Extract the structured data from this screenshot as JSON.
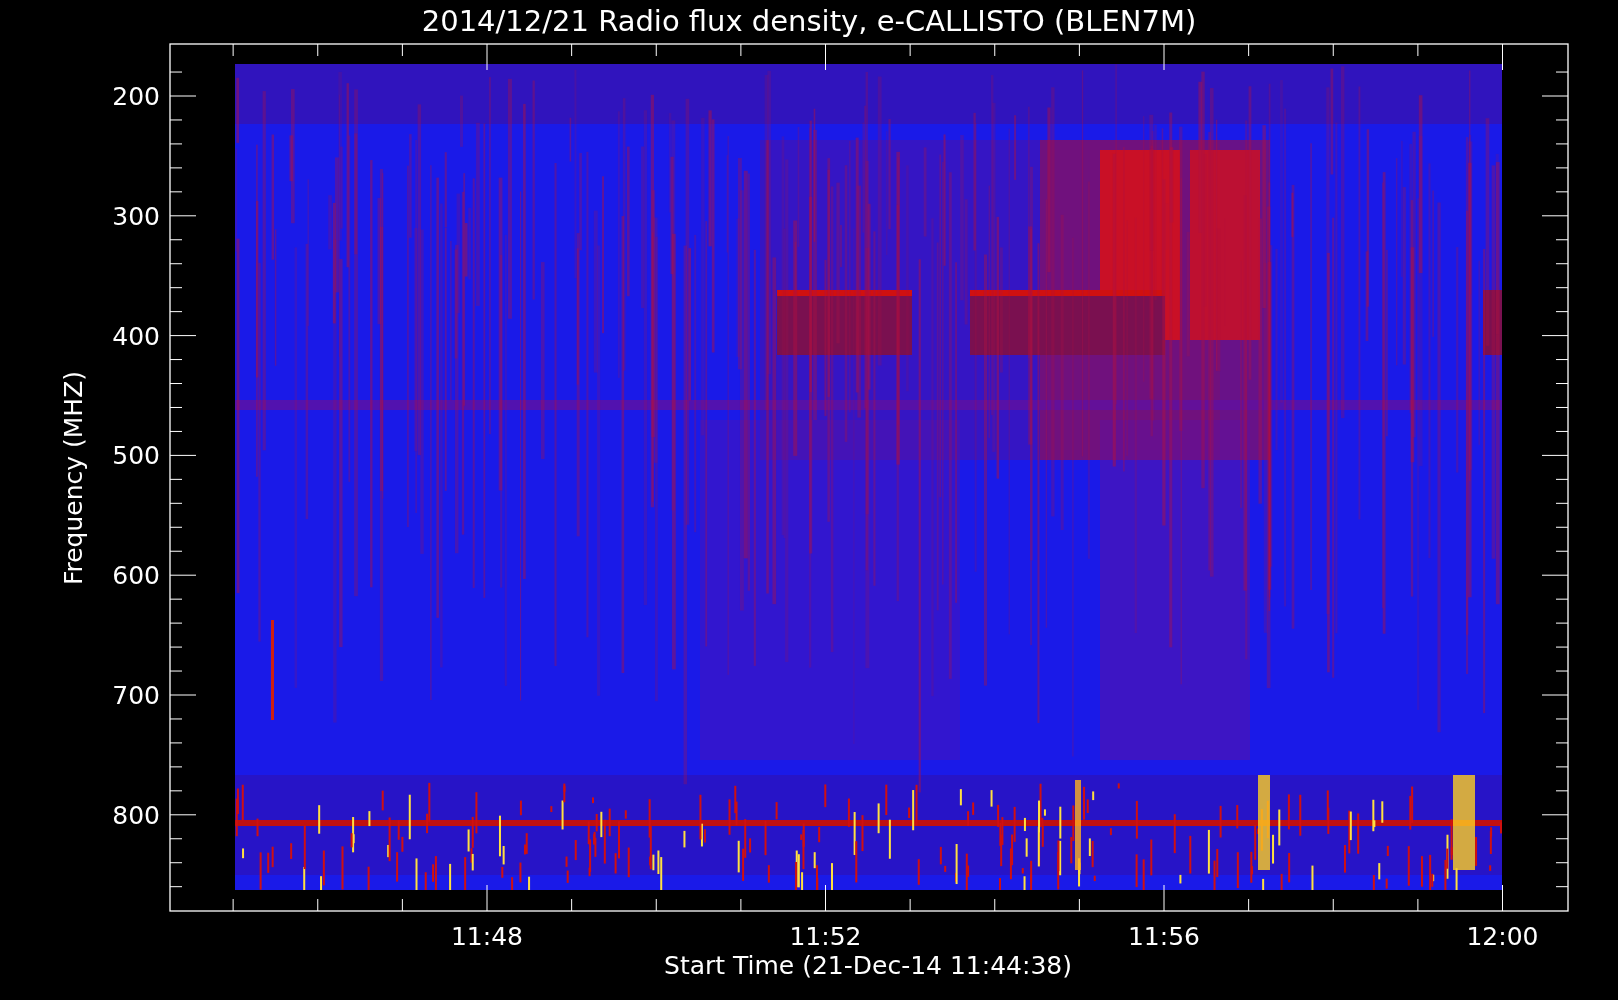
{
  "title": "2014/12/21  Radio flux density, e-CALLISTO (BLEN7M)",
  "y_axis": {
    "label": "Frequency (MHZ)",
    "ticks": [
      "200",
      "300",
      "400",
      "500",
      "600",
      "700",
      "800"
    ]
  },
  "x_axis": {
    "label": "Start Time (21-Dec-14 11:44:38)",
    "ticks": [
      "11:48",
      "11:52",
      "11:56",
      "12:00"
    ]
  }
}
